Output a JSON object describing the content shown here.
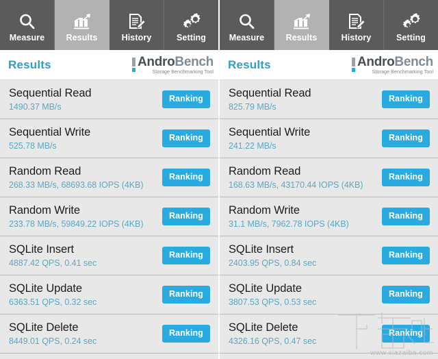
{
  "app": {
    "name": "AndroBench",
    "logo_primary": "Andro",
    "logo_secondary": "Bench",
    "logo_tagline": "Storage Benchmarking Tool",
    "accent_color": "#29abe2",
    "title_color": "#2f9fc4",
    "tabbar_color": "#5b5b5b",
    "tab_active_color": "#b2b2b2",
    "row_color": "#e8e8e8"
  },
  "tabs": [
    {
      "label": "Measure",
      "icon": "magnifier-icon",
      "active": false
    },
    {
      "label": "Results",
      "icon": "bar-chart-icon",
      "active": true
    },
    {
      "label": "History",
      "icon": "document-pencil-icon",
      "active": false
    },
    {
      "label": "Setting",
      "icon": "gears-icon",
      "active": false
    }
  ],
  "section_title": "Results",
  "ranking_label": "Ranking",
  "panels": [
    {
      "id": "left-device",
      "rows": [
        {
          "name": "Sequential Read",
          "value": "1490.37 MB/s"
        },
        {
          "name": "Sequential Write",
          "value": "525.78 MB/s"
        },
        {
          "name": "Random Read",
          "value": "268.33 MB/s, 68693.68 IOPS (4KB)"
        },
        {
          "name": "Random Write",
          "value": "233.78 MB/s, 59849.22 IOPS (4KB)"
        },
        {
          "name": "SQLite Insert",
          "value": "4887.42 QPS, 0.41 sec"
        },
        {
          "name": "SQLite Update",
          "value": "6363.51 QPS, 0.32 sec"
        },
        {
          "name": "SQLite Delete",
          "value": "8449.01 QPS, 0.24 sec"
        }
      ]
    },
    {
      "id": "right-device",
      "rows": [
        {
          "name": "Sequential Read",
          "value": "825.79 MB/s"
        },
        {
          "name": "Sequential Write",
          "value": "241.22 MB/s"
        },
        {
          "name": "Random Read",
          "value": "168.63 MB/s, 43170.44 IOPS (4KB)"
        },
        {
          "name": "Random Write",
          "value": "31.1 MB/s, 7962.78 IOPS (4KB)"
        },
        {
          "name": "SQLite Insert",
          "value": "2403.95 QPS, 0.84 sec"
        },
        {
          "name": "SQLite Update",
          "value": "3807.53 QPS, 0.53 sec"
        },
        {
          "name": "SQLite Delete",
          "value": "4326.16 QPS, 0.47 sec"
        }
      ]
    }
  ],
  "watermark": {
    "text": "下载吧",
    "url": "www.xiazaiba.com"
  }
}
